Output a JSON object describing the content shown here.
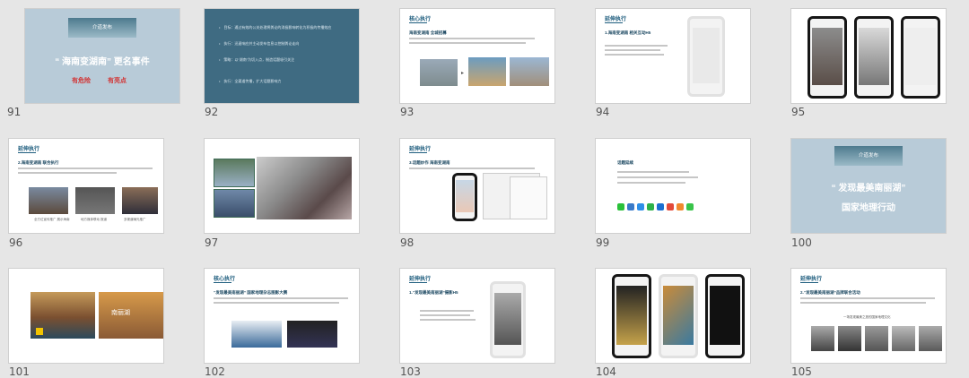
{
  "slides": [
    {
      "num": "91",
      "badge": "介道发布",
      "title": "“ 海南变湖南” 更名事件",
      "red1": "有危险",
      "red2": "有亮点",
      "bullets": [
        "目标：通过有效的公关处理将舆论的消极影响转化为积极的传播效应",
        "执行：迅速响应并主动发布信息以控制舆论走向",
        "策略：以“湖南”为切入点，制造话题吸引关注",
        "执行：全渠道传播，扩大话题影响力"
      ]
    },
    {
      "num": "92"
    },
    {
      "num": "93",
      "header": "核心执行",
      "sub": "海南变湖南  全城招募"
    },
    {
      "num": "94",
      "header": "延伸执行",
      "sub": "1.海南变湖南  相关互动H5"
    },
    {
      "num": "95"
    },
    {
      "num": "96",
      "header": "延伸执行",
      "sub": "2.海南变湖南  联合执行",
      "caps": [
        "全方位宣传推广 展示海南",
        "地方媒体联动 报道",
        "多渠道曝光推广"
      ]
    },
    {
      "num": "97"
    },
    {
      "num": "98",
      "header": "延伸执行",
      "sub": "3.话题炒作  海南变湖南"
    },
    {
      "num": "99",
      "header": "话题延续"
    },
    {
      "num": "100",
      "badge": "介道发布",
      "title": "“ 发现最美南丽湖”",
      "title2": "国家地理行动"
    },
    {
      "num": "101",
      "logo": "南丽湖"
    },
    {
      "num": "102",
      "header": "核心执行",
      "sub": "“发现最美南丽湖”  国家地理杂志图影大赛"
    },
    {
      "num": "103",
      "header": "延伸执行",
      "sub": "1.“发现最美南丽湖”摄影H5"
    },
    {
      "num": "104"
    },
    {
      "num": "105",
      "header": "延伸执行",
      "sub": "2.“发现最美南丽湖”品牌联合活动",
      "tag": "一场发现最美之旅的国家地理文化"
    }
  ],
  "colors": {
    "accent": "#1e5d7e",
    "red": "#d23434",
    "slide_blue": "#b8cbd8",
    "slide_teal": "#3f6b82"
  },
  "icons": [
    "wechat-icon",
    "weibo-icon",
    "zhihu-icon",
    "douban-icon",
    "tieba-icon",
    "youku-icon",
    "tudou-icon"
  ]
}
